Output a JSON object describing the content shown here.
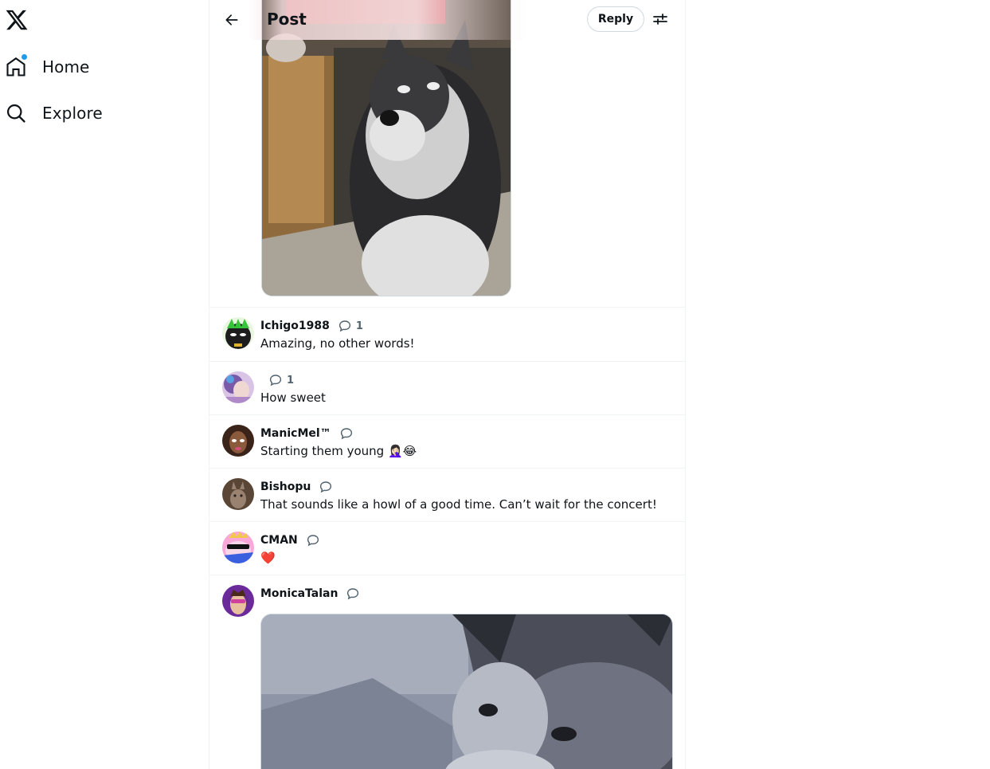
{
  "nav": {
    "home_label": "Home",
    "explore_label": "Explore",
    "home_has_notification": true,
    "notification_color": "#1d9bf0"
  },
  "header": {
    "title": "Post",
    "reply_label": "Reply"
  },
  "replies": [
    {
      "username": "Ichigo1988",
      "comment_count": "1",
      "text": "Amazing, no other words!"
    },
    {
      "username": "",
      "comment_count": "1",
      "text": "How sweet"
    },
    {
      "username": "ManicMel™",
      "comment_count": "",
      "text": "Starting them young 🤦🏻‍♀️😂"
    },
    {
      "username": "Bishopu",
      "comment_count": "",
      "text": "That sounds like a howl of a good time. Can’t wait for the concert!"
    },
    {
      "username": "CMAN",
      "comment_count": "",
      "text": "❤️"
    },
    {
      "username": "MonicaTalan",
      "comment_count": "",
      "text": ""
    }
  ],
  "icons": {
    "logo": "x-logo-icon",
    "home": "home-icon",
    "explore": "search-icon",
    "back": "back-arrow-icon",
    "settings": "sliders-icon",
    "comment": "comment-icon"
  },
  "colors": {
    "accent": "#1d9bf0",
    "text": "#0f1419",
    "muted": "#536471",
    "border": "#eff3f4"
  }
}
